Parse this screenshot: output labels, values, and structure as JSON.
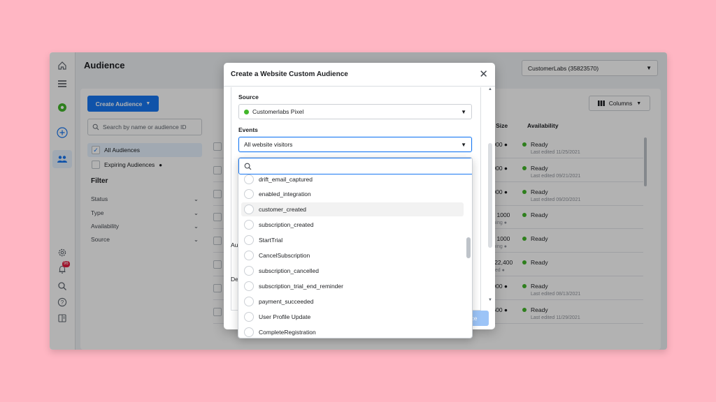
{
  "app": {
    "page_title": "Audience",
    "account_selector": "CustomerLabs (35823570)"
  },
  "rail_icons": [
    "home-icon",
    "menu-icon",
    "account-avatar-icon",
    "plus-circle-icon",
    "people-icon",
    "gear-icon",
    "bell-icon",
    "search-icon",
    "help-icon",
    "panel-icon"
  ],
  "notifications_badge": "96",
  "sidebar": {
    "create_button": "Create Audience",
    "search_placeholder": "Search by name or audience ID",
    "views": [
      {
        "label": "All Audiences",
        "checked": true
      },
      {
        "label": "Expiring Audiences",
        "checked": false
      }
    ],
    "filter_heading": "Filter",
    "filters": [
      "Status",
      "Type",
      "Availability",
      "Source"
    ]
  },
  "table": {
    "columns_button": "Columns",
    "headers": {
      "size": "e Size",
      "availability": "Availability"
    },
    "rows": [
      {
        "size": ",000",
        "size_sub": "",
        "status": "Ready",
        "note": "Last edited 11/25/2021"
      },
      {
        "size": ",000",
        "size_sub": "",
        "status": "Ready",
        "note": "Last edited 09/21/2021"
      },
      {
        "size": ",000",
        "size_sub": "",
        "status": "Ready",
        "note": "Last edited 09/20/2021"
      },
      {
        "size": "w 1000",
        "size_sub": "ching",
        "status": "Ready",
        "note": ""
      },
      {
        "size": "w 1000",
        "size_sub": "ching",
        "status": "Ready",
        "note": ""
      },
      {
        "size": "- 22,400",
        "size_sub": "ated",
        "status": "Ready",
        "note": ""
      },
      {
        "size": ",000",
        "size_sub": "",
        "status": "Ready",
        "note": "Last edited 08/13/2021"
      },
      {
        "size": ",600",
        "size_sub": "",
        "status": "Ready",
        "note": "Last edited 11/29/2021"
      }
    ]
  },
  "modal": {
    "title": "Create a Website Custom Audience",
    "source_label": "Source",
    "source_value": "Customerlabs Pixel",
    "events_label": "Events",
    "events_value": "All website visitors",
    "partial_label_1": "Au",
    "partial_label_2": "De",
    "behind_button": "ce"
  },
  "dropdown": {
    "search_value": "",
    "items": [
      "drift_email_captured",
      "enabled_integration",
      "customer_created",
      "subscription_created",
      "StartTrial",
      "CancelSubscription",
      "subscription_cancelled",
      "subscription_trial_end_reminder",
      "payment_succeeded",
      "User Profile Update",
      "CompleteRegistration"
    ],
    "hovered_item": "customer_created"
  },
  "colors": {
    "page_background": "#ffb6c3",
    "accent": "#1877f2",
    "ready_dot": "#42b72a"
  }
}
